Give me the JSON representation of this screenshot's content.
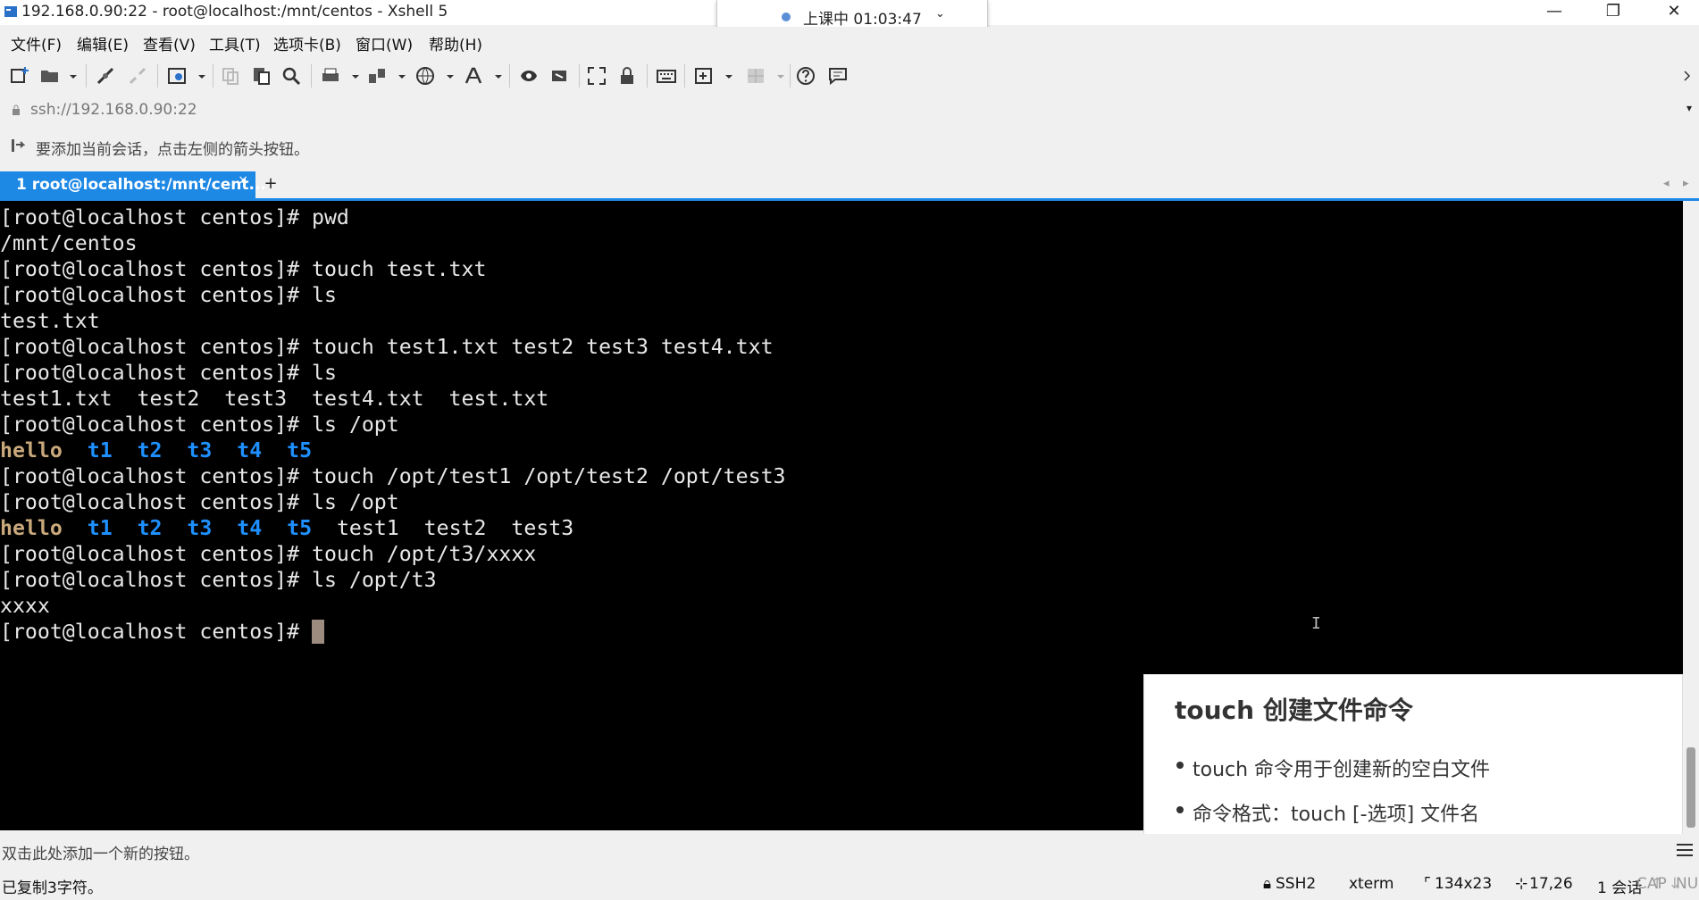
{
  "window": {
    "title": "192.168.0.90:22 - root@localhost:/mnt/centos - Xshell 5",
    "minimize": "—",
    "maximize": "❐",
    "close": "✕"
  },
  "class_timer": {
    "label": "上课中 01:03:47",
    "chevron": "⌄"
  },
  "menu": [
    "文件(F)",
    "编辑(E)",
    "查看(V)",
    "工具(T)",
    "选项卡(B)",
    "窗口(W)",
    "帮助(H)"
  ],
  "address": {
    "value": "ssh://192.168.0.90:22",
    "dropdown": "▾"
  },
  "hint": {
    "text": "要添加当前会话，点击左侧的箭头按钮。"
  },
  "tabs": [
    {
      "label": "1 root@localhost:/mnt/cent...",
      "close": "×"
    }
  ],
  "tab_add": "+",
  "tab_nav": {
    "prev": "◂",
    "next": "▸"
  },
  "terminal": {
    "lines": [
      "[root@localhost centos]# pwd",
      "/mnt/centos",
      "[root@localhost centos]# touch test.txt",
      "[root@localhost centos]# ls",
      "test.txt",
      "[root@localhost centos]# touch test1.txt test2 test3 test4.txt",
      "[root@localhost centos]# ls",
      "test1.txt  test2  test3  test4.txt  test.txt",
      "[root@localhost centos]# ls /opt",
      "",
      "[root@localhost centos]# touch /opt/test1 /opt/test2 /opt/test3",
      "[root@localhost centos]# ls /opt",
      "",
      "[root@localhost centos]# touch /opt/t3/xxxx",
      "[root@localhost centos]# ls /opt/t3",
      "xxxx",
      "[root@localhost centos]# "
    ],
    "opt_listing_1": {
      "hello": "hello",
      "dirs": [
        "t1",
        "t2",
        "t3",
        "t4",
        "t5"
      ]
    },
    "opt_listing_2": {
      "hello": "hello",
      "dirs": [
        "t1",
        "t2",
        "t3",
        "t4",
        "t5"
      ],
      "files": "test1  test2  test3"
    }
  },
  "mouse_cursor": "I",
  "slide": {
    "title": "touch 创建文件命令",
    "bullets": [
      "touch 命令用于创建新的空白文件",
      "命令格式：touch [-选项] 文件名"
    ]
  },
  "button_bar": {
    "text": "双击此处添加一个新的按钮。"
  },
  "status": {
    "message": "已复制3字符。",
    "protocol": "SSH2",
    "term": "xterm",
    "size": "134x23",
    "cursor_pos": "17,26",
    "sessions": "1 会话",
    "arrows": "↑ ↓",
    "caps": "CAP",
    "num": "NU"
  },
  "colors": {
    "accent": "#1e88e5",
    "dir": "#1e90ff",
    "hello": "#c9a97c",
    "cursor": "#9e8b7f"
  }
}
